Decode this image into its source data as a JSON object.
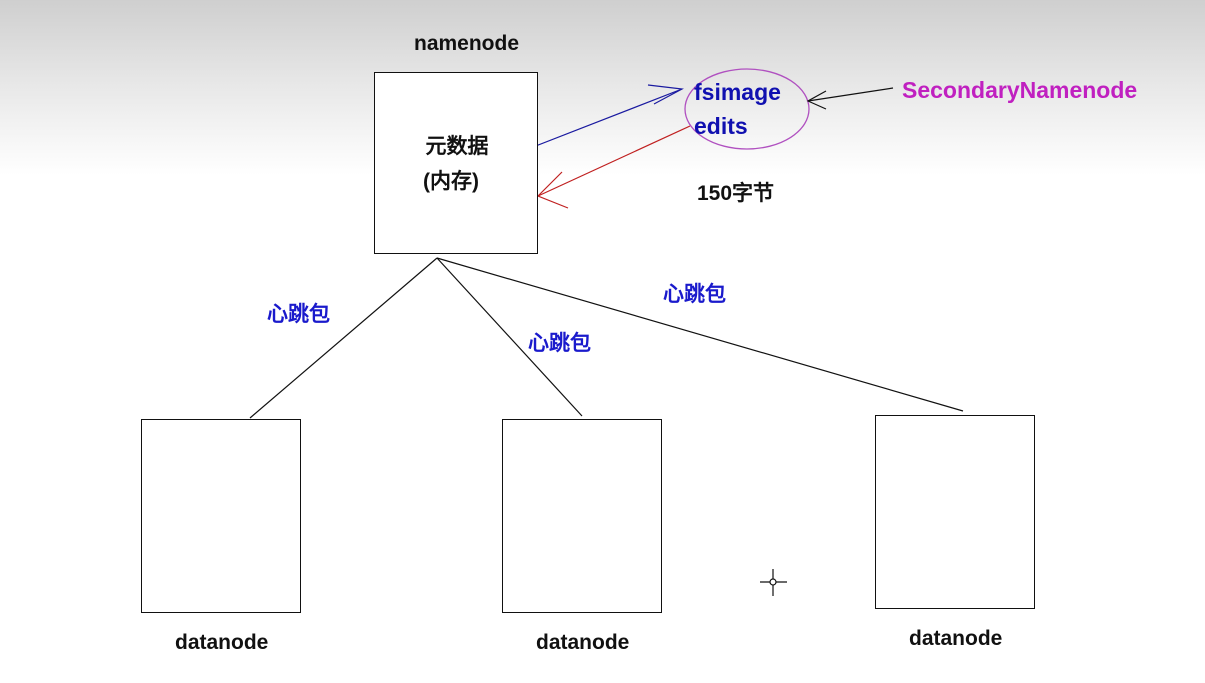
{
  "namenode": {
    "title": "namenode",
    "content_line1": "元数据",
    "content_line2": "(内存)"
  },
  "metadata_files": {
    "fsimage": "fsimage",
    "edits": "edits",
    "size_note": "150字节"
  },
  "secondary": {
    "label": "SecondaryNamenode"
  },
  "heartbeats": [
    "心跳包",
    "心跳包",
    "心跳包"
  ],
  "datanodes": [
    "datanode",
    "datanode",
    "datanode"
  ],
  "colors": {
    "heartbeat_text": "#1a1acc",
    "fsimage_text": "#1010b0",
    "secondary_text": "#c020c0",
    "ellipse": "#b050c0",
    "arrow_to_fsimage": "#1a1aa0",
    "arrow_from_edits": "#c02020",
    "lines": "#111111"
  },
  "icons": {
    "cursor": "crosshair-cursor-icon"
  }
}
